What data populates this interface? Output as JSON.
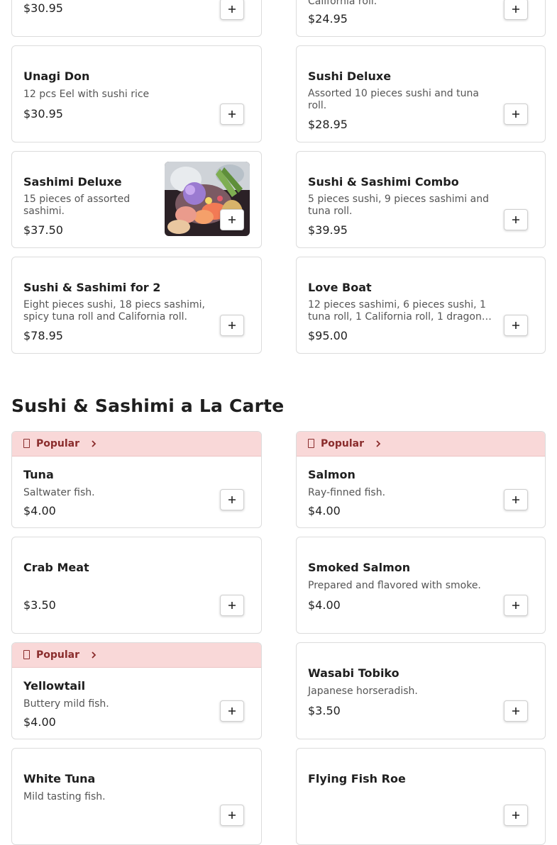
{
  "page": {
    "background": "#ffffff"
  },
  "section": {
    "title": "Sushi & Sashimi a La Carte"
  },
  "popular_label": "Popular",
  "colors": {
    "popular_bg": "#f9d8d8",
    "popular_text": "#8a2c2c"
  },
  "items": [
    {
      "id": "item0",
      "price": "$30.95"
    },
    {
      "id": "item1",
      "desc": "California roll.",
      "price": "$24.95"
    },
    {
      "id": "item2",
      "name": "Unagi Don",
      "desc": "12 pcs Eel with sushi rice",
      "price": "$30.95"
    },
    {
      "id": "item3",
      "name": "Sushi Deluxe",
      "desc": "Assorted 10 pieces sushi and tuna roll.",
      "price": "$28.95"
    },
    {
      "id": "item4",
      "name": "Sashimi Deluxe",
      "desc": "15 pieces of assorted sashimi.",
      "price": "$37.50",
      "has_image": true
    },
    {
      "id": "item5",
      "name": "Sushi & Sashimi Combo",
      "desc": "5 pieces sushi, 9 pieces sashimi and tuna roll.",
      "price": "$39.95"
    },
    {
      "id": "item6",
      "name": "Sushi & Sashimi for 2",
      "desc": "Eight pieces sushi, 18 piecs sashimi, spicy tuna roll and California roll.",
      "price": "$78.95"
    },
    {
      "id": "item7",
      "name": "Love Boat",
      "desc": "12 pieces sashimi, 6 pieces sushi, 1 tuna roll, 1 California roll, 1 dragon…",
      "price": "$95.00"
    },
    {
      "id": "item8",
      "name": "Tuna",
      "desc": "Saltwater fish.",
      "price": "$4.00",
      "popular": true
    },
    {
      "id": "item9",
      "name": "Salmon",
      "desc": "Ray-finned fish.",
      "price": "$4.00",
      "popular": true
    },
    {
      "id": "item10",
      "name": "Crab Meat",
      "price": "$3.50"
    },
    {
      "id": "item11",
      "name": "Smoked Salmon",
      "desc": "Prepared and flavored with smoke.",
      "price": "$4.00"
    },
    {
      "id": "item12",
      "name": "Yellowtail",
      "desc": "Buttery mild fish.",
      "price": "$4.00",
      "popular": true
    },
    {
      "id": "item13",
      "name": "Wasabi Tobiko",
      "desc": "Japanese horseradish.",
      "price": "$3.50"
    },
    {
      "id": "item14",
      "name": "White Tuna",
      "desc": "Mild tasting fish."
    },
    {
      "id": "item15",
      "name": "Flying Fish Roe"
    }
  ]
}
